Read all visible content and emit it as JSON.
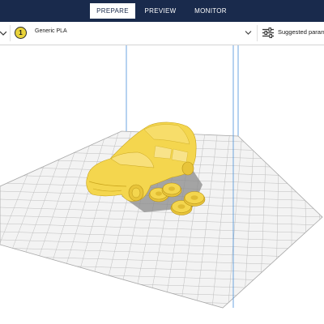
{
  "stages": {
    "prepare": "PREPARE",
    "preview": "PREVIEW",
    "monitor": "MONITOR"
  },
  "extruder": {
    "number": "1",
    "material": "Generic PLA",
    "material_color": "#e9d33a"
  },
  "print_settings": {
    "label": "Suggested param"
  },
  "icons": {
    "left_chevron": "chevron-down-icon",
    "material_dropdown": "chevron-down-icon",
    "settings": "sliders-icon"
  },
  "colors": {
    "header_background": "#192a4c",
    "model_color": "#f4d64e",
    "build_volume_lines": "#4a90d9",
    "build_plate": "#f2f2f2"
  }
}
